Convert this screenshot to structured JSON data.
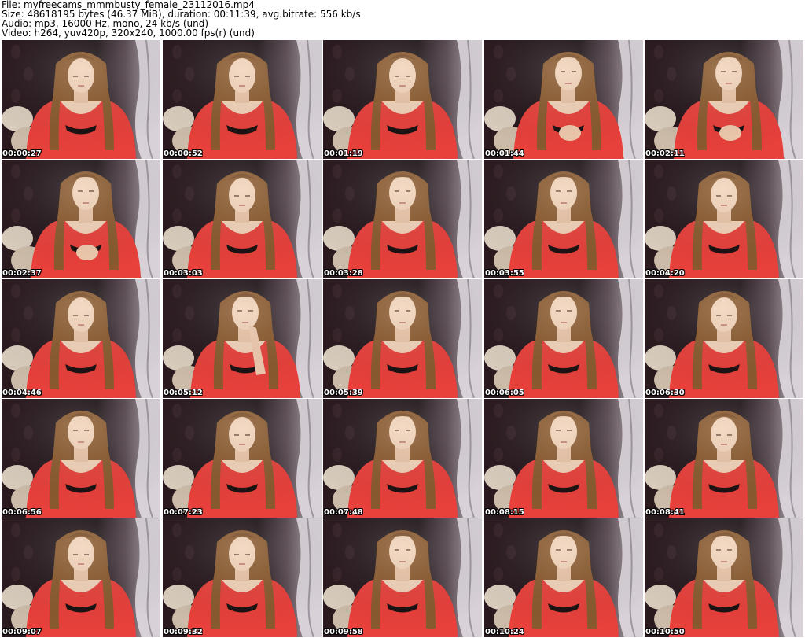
{
  "header": {
    "file_line": "File: myfreecams_mmmbusty_female_23112016.mp4",
    "size_line": "Size: 48618195 bytes (46.37 MiB), duration: 00:11:39, avg.bitrate: 556 kb/s",
    "audio_line": "Audio: mp3, 16000 Hz, mono, 24 kb/s (und)",
    "video_line": "Video: h264, yuv420p, 320x240, 1000.00 fps(r) (und)"
  },
  "thumbnails": [
    {
      "timestamp": "00:00:27",
      "pose": "down"
    },
    {
      "timestamp": "00:00:52",
      "pose": "down"
    },
    {
      "timestamp": "00:01:19",
      "pose": "down"
    },
    {
      "timestamp": "00:01:44",
      "pose": "hand"
    },
    {
      "timestamp": "00:02:11",
      "pose": "hand"
    },
    {
      "timestamp": "00:02:37",
      "pose": "hand"
    },
    {
      "timestamp": "00:03:03",
      "pose": "down"
    },
    {
      "timestamp": "00:03:28",
      "pose": "front"
    },
    {
      "timestamp": "00:03:55",
      "pose": "front"
    },
    {
      "timestamp": "00:04:20",
      "pose": "down"
    },
    {
      "timestamp": "00:04:46",
      "pose": "down"
    },
    {
      "timestamp": "00:05:12",
      "pose": "chin"
    },
    {
      "timestamp": "00:05:39",
      "pose": "front"
    },
    {
      "timestamp": "00:06:05",
      "pose": "front"
    },
    {
      "timestamp": "00:06:30",
      "pose": "down"
    },
    {
      "timestamp": "00:06:56",
      "pose": "front"
    },
    {
      "timestamp": "00:07:23",
      "pose": "down"
    },
    {
      "timestamp": "00:07:48",
      "pose": "front"
    },
    {
      "timestamp": "00:08:15",
      "pose": "front"
    },
    {
      "timestamp": "00:08:41",
      "pose": "down"
    },
    {
      "timestamp": "00:09:07",
      "pose": "down"
    },
    {
      "timestamp": "00:09:32",
      "pose": "down"
    },
    {
      "timestamp": "00:09:58",
      "pose": "front"
    },
    {
      "timestamp": "00:10:24",
      "pose": "front"
    },
    {
      "timestamp": "00:10:50",
      "pose": "front"
    }
  ],
  "colors": {
    "background": "#ffffff",
    "dress": "#e8403a",
    "hair": "#8a5a2e",
    "skin": "#f2d2b8",
    "wall_dark": "#1e1418",
    "curtain": "#c9c2c8",
    "timestamp_text": "#ffffff"
  }
}
